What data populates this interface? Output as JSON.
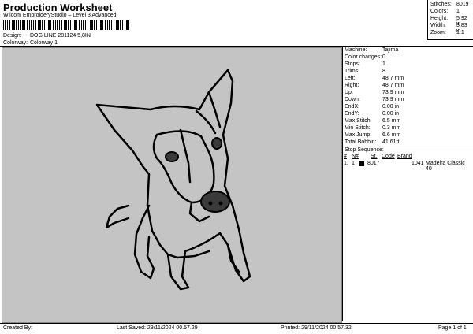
{
  "header": {
    "title": "Production Worksheet",
    "subtitle": "Wilcom EmbroideryStudio – Level 3 Advanced"
  },
  "design": {
    "label": "Design:",
    "value": "DOG LINE 281124 5,8IN"
  },
  "colorway": {
    "label": "Colorway:",
    "value": "Colorway 1"
  },
  "stats": [
    {
      "label": "Stitches:",
      "value": "8019"
    },
    {
      "label": "Colors:",
      "value": "1"
    },
    {
      "label": "Height:",
      "value": "5.92 in"
    },
    {
      "label": "Width:",
      "value": "3.83 in"
    },
    {
      "label": "Zoom:",
      "value": "1:1"
    }
  ],
  "machine_info": [
    {
      "label": "Machine:",
      "value": "Tajima"
    },
    {
      "label": "Color changes:",
      "value": "0"
    },
    {
      "label": "Stops:",
      "value": "1"
    },
    {
      "label": "Trims:",
      "value": "8"
    },
    {
      "label": "Left:",
      "value": "48.7 mm"
    },
    {
      "label": "Right:",
      "value": "48.7 mm"
    },
    {
      "label": "Up:",
      "value": "73.9 mm"
    },
    {
      "label": "Down:",
      "value": "73.9 mm"
    },
    {
      "label": "EndX:",
      "value": "0.00 in"
    },
    {
      "label": "EndY:",
      "value": "0.00 in"
    },
    {
      "label": "Max Stitch:",
      "value": "6.5 mm"
    },
    {
      "label": "Min Stitch:",
      "value": "0.3 mm"
    },
    {
      "label": "Max Jump:",
      "value": "6.6 mm"
    },
    {
      "label": "Total Bobbin:",
      "value": "41.61ft"
    }
  ],
  "stop_sequence": {
    "title": "Stop Sequence:",
    "headers": [
      "#",
      "N#",
      "St.",
      "Code",
      "Brand"
    ],
    "rows": [
      {
        "num": "1.",
        "needle": "1",
        "color_hex": "#000000",
        "stitches": "8017",
        "code": "1041",
        "brand": "Madeira Classic 40"
      }
    ]
  },
  "footer": {
    "created_by": "Created By:",
    "last_saved": "Last Saved: 29/11/2024 00.57.29",
    "printed": "Printed: 29/11/2024 00.57.32",
    "page": "Page 1 of 1"
  },
  "colors": {
    "canvas_bg": "#c4c4c4",
    "thread": "#000000"
  }
}
